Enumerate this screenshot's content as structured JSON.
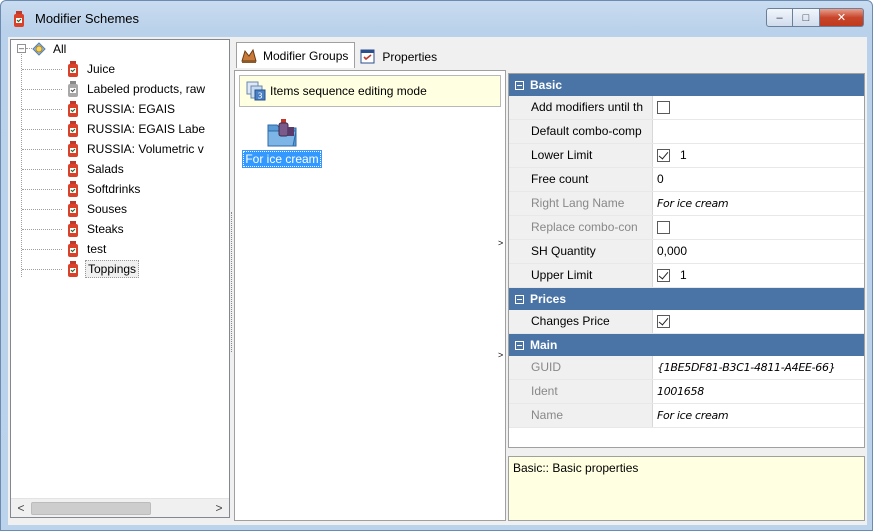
{
  "window": {
    "title": "Modifier Schemes",
    "buttons": {
      "minimize": "–",
      "maximize": "□",
      "close": "✕"
    }
  },
  "tree": {
    "root": {
      "label": "All",
      "expander": "–"
    },
    "items": [
      {
        "label": "Juice",
        "icon": "bottle-red-icon"
      },
      {
        "label": "Labeled products, raw",
        "icon": "bottle-gray-icon"
      },
      {
        "label": "RUSSIA: EGAIS",
        "icon": "bottle-red-icon"
      },
      {
        "label": "RUSSIA: EGAIS Labe",
        "icon": "bottle-red-icon"
      },
      {
        "label": "RUSSIA: Volumetric v",
        "icon": "bottle-red-icon"
      },
      {
        "label": "Salads",
        "icon": "bottle-red-icon"
      },
      {
        "label": "Softdrinks",
        "icon": "bottle-red-icon"
      },
      {
        "label": "Souses",
        "icon": "bottle-red-icon"
      },
      {
        "label": "Steaks",
        "icon": "bottle-red-icon"
      },
      {
        "label": "test",
        "icon": "bottle-red-icon"
      },
      {
        "label": "Toppings",
        "icon": "bottle-red-icon",
        "selected": true
      }
    ],
    "scroll": {
      "left": "<",
      "right": ">"
    }
  },
  "tabs": [
    {
      "label": "Modifier Groups",
      "active": true
    },
    {
      "label": "Properties",
      "active": false
    }
  ],
  "groups": {
    "sequence_button": "Items sequence editing mode",
    "items": [
      {
        "label": "For ice cream",
        "selected": true
      }
    ]
  },
  "properties": {
    "categories": [
      {
        "name": "Basic",
        "rows": [
          {
            "name": "Add modifiers until th",
            "value": "",
            "checkbox": false
          },
          {
            "name": "Default combo-comp",
            "value": ""
          },
          {
            "name": "Lower Limit",
            "value": "1",
            "checkbox": true
          },
          {
            "name": "Free count",
            "value": "0"
          },
          {
            "name": "Right Lang Name",
            "value": "For ice cream",
            "disabled": true
          },
          {
            "name": "Replace combo-con",
            "value": "",
            "checkbox": false,
            "disabled": true
          },
          {
            "name": "SH Quantity",
            "value": "0,000"
          },
          {
            "name": "Upper Limit",
            "value": "1",
            "checkbox": true
          }
        ]
      },
      {
        "name": "Prices",
        "rows": [
          {
            "name": "Changes Price",
            "value": "",
            "checkbox": true
          }
        ]
      },
      {
        "name": "Main",
        "rows": [
          {
            "name": "GUID",
            "value": "{1BE5DF81-B3C1-4811-A4EE-66}",
            "disabled": true
          },
          {
            "name": "Ident",
            "value": "1001658",
            "disabled": true
          },
          {
            "name": "Name",
            "value": "For ice cream",
            "disabled": true
          }
        ]
      }
    ],
    "collapse_arrow": ">",
    "description": "Basic:: Basic properties"
  }
}
